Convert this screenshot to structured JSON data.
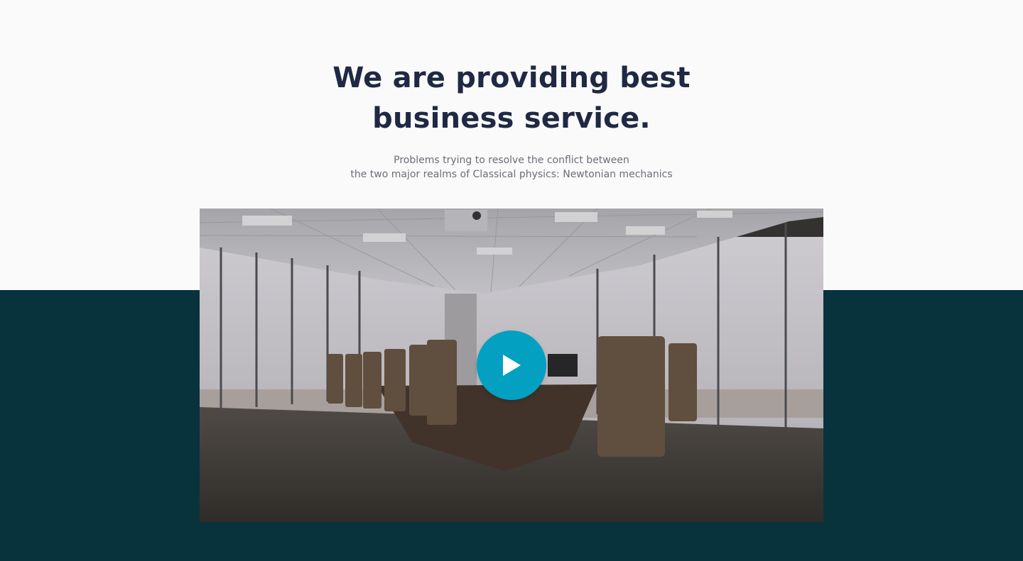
{
  "hero": {
    "title_line1": "We are providing best",
    "title_line2": "business service.",
    "subtitle_line1": "Problems trying to resolve the conflict between",
    "subtitle_line2": "the two major realms of Classical physics: Newtonian mechanics"
  },
  "video": {
    "thumbnail": "conference-room-photo",
    "play_icon": "play-icon",
    "play_button_color": "#03a0c2"
  },
  "colors": {
    "top_background": "#fafafb",
    "bottom_background": "#08333d",
    "heading": "#1f2944",
    "body_text": "#6b6e75"
  }
}
